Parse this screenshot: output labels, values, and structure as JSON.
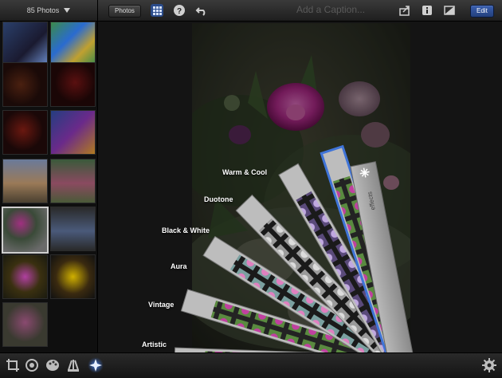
{
  "app": {
    "album_label": "85 Photos",
    "photos_button": "Photos",
    "caption_placeholder": "Add a Caption...",
    "edit_button": "Edit"
  },
  "effects_panel": {
    "title": "effects",
    "labels": [
      "Warm & Cool",
      "Duotone",
      "Black & White",
      "Aura",
      "Vintage",
      "Artistic"
    ]
  },
  "toolbar_icons": [
    "grid-view-icon",
    "help-icon",
    "undo-icon",
    "share-icon",
    "info-icon",
    "compare-icon"
  ],
  "bottom_tools": [
    "crop-icon",
    "exposure-icon",
    "color-icon",
    "brushes-icon",
    "effects-icon",
    "settings-icon"
  ],
  "colors": {
    "accent_blue": "#3f74d8",
    "edit_button": "#2d4f96",
    "background": "#161616"
  }
}
